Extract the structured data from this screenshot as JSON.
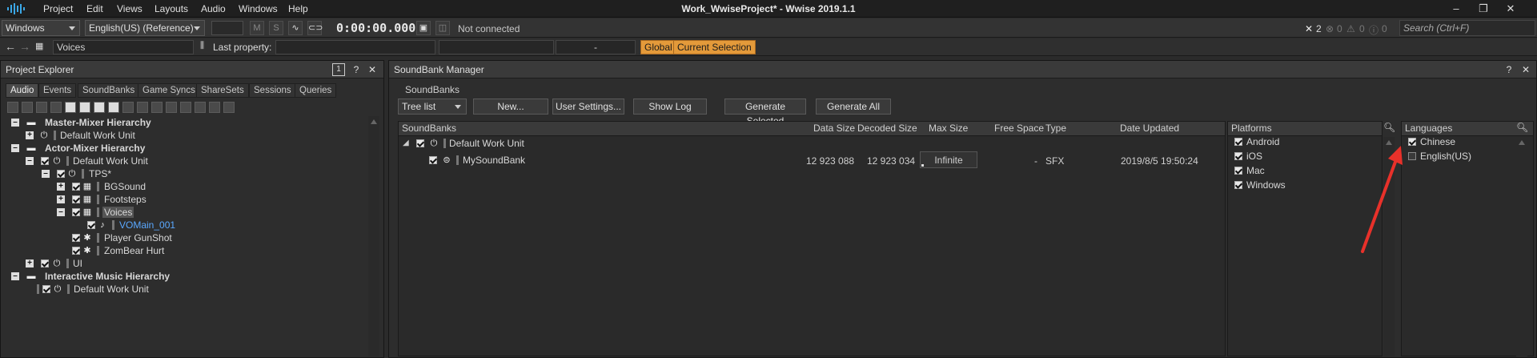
{
  "menu": {
    "items": [
      "Project",
      "Edit",
      "Views",
      "Layouts",
      "Audio",
      "Windows",
      "Help"
    ]
  },
  "app_title": "Work_WwiseProject* - Wwise 2019.1.1",
  "window_controls": {
    "minimize": "–",
    "maximize": "❐",
    "close": "✕"
  },
  "toolbar": {
    "platform": "Windows",
    "language": "English(US) (Reference)",
    "btn_m": "M",
    "btn_s": "S",
    "timecode": "0:00:00.000",
    "connection_status": "Not connected",
    "errors": "2",
    "warnings": "0",
    "alerts": "0",
    "infos": "0",
    "search_placeholder": "Search (Ctrl+F)"
  },
  "toolbar2": {
    "selected_object": "Voices",
    "last_property_label": "Last property:",
    "last_property_value": "",
    "dash": "-",
    "global": "Global",
    "current_selection": "Current Selection"
  },
  "project_explorer": {
    "title": "Project Explorer",
    "badge": "1",
    "tabs": [
      "Audio",
      "Events",
      "SoundBanks",
      "Game Syncs",
      "ShareSets",
      "Sessions",
      "Queries"
    ],
    "tree": [
      "Master-Mixer Hierarchy",
      "Default Work Unit",
      "Actor-Mixer Hierarchy",
      "Default Work Unit",
      "TPS*",
      "BGSound",
      "Footsteps",
      "Voices",
      "VOMain_001",
      "Player GunShot",
      "ZomBear Hurt",
      "UI",
      "Interactive Music Hierarchy",
      "Default Work Unit"
    ]
  },
  "soundbank_manager": {
    "title": "SoundBank Manager",
    "section": "SoundBanks",
    "view_mode": "Tree list",
    "buttons": {
      "new": "New...",
      "user_settings": "User Settings...",
      "show_log": "Show Log",
      "generate_selected": "Generate Selected",
      "generate_all": "Generate All"
    },
    "columns": [
      "SoundBanks",
      "Data Size",
      "Decoded Size",
      "Max Size",
      "Free Space",
      "Type",
      "Date Updated"
    ],
    "work_unit": "Default Work Unit",
    "bank": {
      "name": "MySoundBank",
      "data_size": "12 923 088",
      "decoded_size": "12 923 034",
      "max_size": "Infinite",
      "free_space": "-",
      "type": "SFX",
      "date_updated": "2019/8/5 19:50:24"
    },
    "platforms": {
      "header": "Platforms",
      "items": [
        "Android",
        "iOS",
        "Mac",
        "Windows"
      ]
    },
    "languages": {
      "header": "Languages",
      "items": [
        "Chinese",
        "English(US)"
      ]
    }
  },
  "colors": {
    "accent_orange": "#e49a3a",
    "annotation_red": "#e8312a",
    "link_blue": "#5aa8ff"
  }
}
